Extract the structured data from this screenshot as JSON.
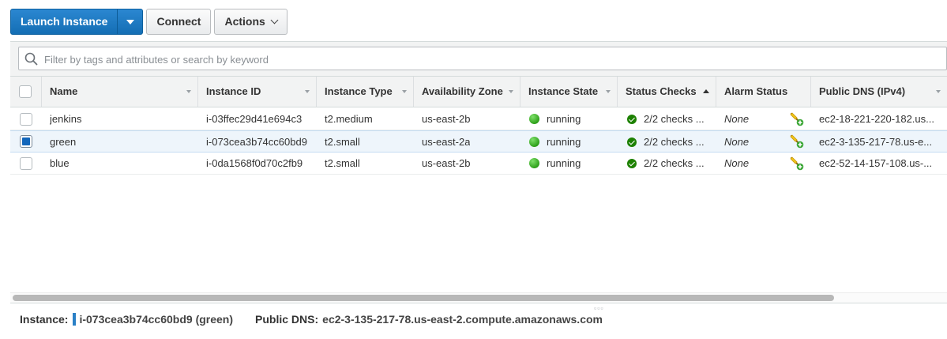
{
  "toolbar": {
    "launch_label": "Launch Instance",
    "connect_label": "Connect",
    "actions_label": "Actions"
  },
  "search": {
    "placeholder": "Filter by tags and attributes or search by keyword",
    "value": ""
  },
  "columns": [
    {
      "label": "Name"
    },
    {
      "label": "Instance ID"
    },
    {
      "label": "Instance Type"
    },
    {
      "label": "Availability Zone"
    },
    {
      "label": "Instance State"
    },
    {
      "label": "Status Checks",
      "sorted": "ascending"
    },
    {
      "label": "Alarm Status"
    },
    {
      "label": "Public DNS (IPv4)"
    }
  ],
  "rows": [
    {
      "selected": false,
      "name": "jenkins",
      "instance_id": "i-03ffec29d41e694c3",
      "type": "t2.medium",
      "zone": "us-east-2b",
      "state": "running",
      "checks": "2/2 checks ...",
      "alarm": "None",
      "dns": "ec2-18-221-220-182.us..."
    },
    {
      "selected": true,
      "name": "green",
      "instance_id": "i-073cea3b74cc60bd9",
      "type": "t2.small",
      "zone": "us-east-2a",
      "state": "running",
      "checks": "2/2 checks ...",
      "alarm": "None",
      "dns": "ec2-3-135-217-78.us-e..."
    },
    {
      "selected": false,
      "name": "blue",
      "instance_id": "i-0da1568f0d70c2fb9",
      "type": "t2.small",
      "zone": "us-east-2b",
      "state": "running",
      "checks": "2/2 checks ...",
      "alarm": "None",
      "dns": "ec2-52-14-157-108.us-..."
    }
  ],
  "details": {
    "instance_label": "Instance:",
    "instance_value": "i-073cea3b74cc60bd9 (green)",
    "dns_label": "Public DNS:",
    "dns_value": "ec2-3-135-217-78.us-east-2.compute.amazonaws.com"
  },
  "colors": {
    "primary": "#146eb4",
    "running": "#2ea01a",
    "check_ok": "#1d8102",
    "selected_row": "#eef5fb"
  },
  "icons": {
    "search": "search-icon",
    "alarm": "create-alarm-icon",
    "state": "running-status-icon",
    "checks": "check-circle-icon"
  }
}
